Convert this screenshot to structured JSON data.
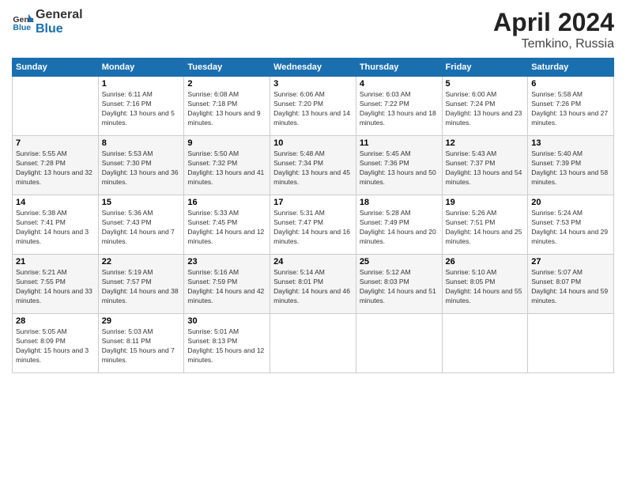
{
  "header": {
    "logo_line1": "General",
    "logo_line2": "Blue",
    "month_year": "April 2024",
    "location": "Temkino, Russia"
  },
  "weekdays": [
    "Sunday",
    "Monday",
    "Tuesday",
    "Wednesday",
    "Thursday",
    "Friday",
    "Saturday"
  ],
  "weeks": [
    [
      {
        "day": "",
        "sunrise": "",
        "sunset": "",
        "daylight": ""
      },
      {
        "day": "1",
        "sunrise": "6:11 AM",
        "sunset": "7:16 PM",
        "daylight": "13 hours and 5 minutes."
      },
      {
        "day": "2",
        "sunrise": "6:08 AM",
        "sunset": "7:18 PM",
        "daylight": "13 hours and 9 minutes."
      },
      {
        "day": "3",
        "sunrise": "6:06 AM",
        "sunset": "7:20 PM",
        "daylight": "13 hours and 14 minutes."
      },
      {
        "day": "4",
        "sunrise": "6:03 AM",
        "sunset": "7:22 PM",
        "daylight": "13 hours and 18 minutes."
      },
      {
        "day": "5",
        "sunrise": "6:00 AM",
        "sunset": "7:24 PM",
        "daylight": "13 hours and 23 minutes."
      },
      {
        "day": "6",
        "sunrise": "5:58 AM",
        "sunset": "7:26 PM",
        "daylight": "13 hours and 27 minutes."
      }
    ],
    [
      {
        "day": "7",
        "sunrise": "5:55 AM",
        "sunset": "7:28 PM",
        "daylight": "13 hours and 32 minutes."
      },
      {
        "day": "8",
        "sunrise": "5:53 AM",
        "sunset": "7:30 PM",
        "daylight": "13 hours and 36 minutes."
      },
      {
        "day": "9",
        "sunrise": "5:50 AM",
        "sunset": "7:32 PM",
        "daylight": "13 hours and 41 minutes."
      },
      {
        "day": "10",
        "sunrise": "5:48 AM",
        "sunset": "7:34 PM",
        "daylight": "13 hours and 45 minutes."
      },
      {
        "day": "11",
        "sunrise": "5:45 AM",
        "sunset": "7:36 PM",
        "daylight": "13 hours and 50 minutes."
      },
      {
        "day": "12",
        "sunrise": "5:43 AM",
        "sunset": "7:37 PM",
        "daylight": "13 hours and 54 minutes."
      },
      {
        "day": "13",
        "sunrise": "5:40 AM",
        "sunset": "7:39 PM",
        "daylight": "13 hours and 58 minutes."
      }
    ],
    [
      {
        "day": "14",
        "sunrise": "5:38 AM",
        "sunset": "7:41 PM",
        "daylight": "14 hours and 3 minutes."
      },
      {
        "day": "15",
        "sunrise": "5:36 AM",
        "sunset": "7:43 PM",
        "daylight": "14 hours and 7 minutes."
      },
      {
        "day": "16",
        "sunrise": "5:33 AM",
        "sunset": "7:45 PM",
        "daylight": "14 hours and 12 minutes."
      },
      {
        "day": "17",
        "sunrise": "5:31 AM",
        "sunset": "7:47 PM",
        "daylight": "14 hours and 16 minutes."
      },
      {
        "day": "18",
        "sunrise": "5:28 AM",
        "sunset": "7:49 PM",
        "daylight": "14 hours and 20 minutes."
      },
      {
        "day": "19",
        "sunrise": "5:26 AM",
        "sunset": "7:51 PM",
        "daylight": "14 hours and 25 minutes."
      },
      {
        "day": "20",
        "sunrise": "5:24 AM",
        "sunset": "7:53 PM",
        "daylight": "14 hours and 29 minutes."
      }
    ],
    [
      {
        "day": "21",
        "sunrise": "5:21 AM",
        "sunset": "7:55 PM",
        "daylight": "14 hours and 33 minutes."
      },
      {
        "day": "22",
        "sunrise": "5:19 AM",
        "sunset": "7:57 PM",
        "daylight": "14 hours and 38 minutes."
      },
      {
        "day": "23",
        "sunrise": "5:16 AM",
        "sunset": "7:59 PM",
        "daylight": "14 hours and 42 minutes."
      },
      {
        "day": "24",
        "sunrise": "5:14 AM",
        "sunset": "8:01 PM",
        "daylight": "14 hours and 46 minutes."
      },
      {
        "day": "25",
        "sunrise": "5:12 AM",
        "sunset": "8:03 PM",
        "daylight": "14 hours and 51 minutes."
      },
      {
        "day": "26",
        "sunrise": "5:10 AM",
        "sunset": "8:05 PM",
        "daylight": "14 hours and 55 minutes."
      },
      {
        "day": "27",
        "sunrise": "5:07 AM",
        "sunset": "8:07 PM",
        "daylight": "14 hours and 59 minutes."
      }
    ],
    [
      {
        "day": "28",
        "sunrise": "5:05 AM",
        "sunset": "8:09 PM",
        "daylight": "15 hours and 3 minutes."
      },
      {
        "day": "29",
        "sunrise": "5:03 AM",
        "sunset": "8:11 PM",
        "daylight": "15 hours and 7 minutes."
      },
      {
        "day": "30",
        "sunrise": "5:01 AM",
        "sunset": "8:13 PM",
        "daylight": "15 hours and 12 minutes."
      },
      {
        "day": "",
        "sunrise": "",
        "sunset": "",
        "daylight": ""
      },
      {
        "day": "",
        "sunrise": "",
        "sunset": "",
        "daylight": ""
      },
      {
        "day": "",
        "sunrise": "",
        "sunset": "",
        "daylight": ""
      },
      {
        "day": "",
        "sunrise": "",
        "sunset": "",
        "daylight": ""
      }
    ]
  ]
}
